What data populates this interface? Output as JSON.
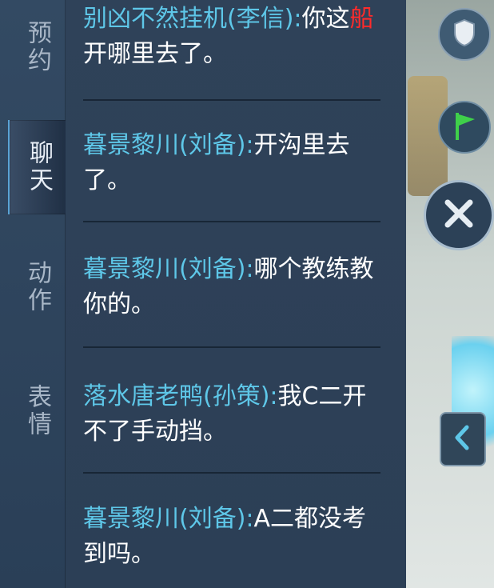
{
  "tabs": [
    {
      "label": "预约",
      "active": false
    },
    {
      "label": "聊天",
      "active": true
    },
    {
      "label": "动作",
      "active": false
    },
    {
      "label": "表情",
      "active": false
    }
  ],
  "messages": [
    {
      "sender": "别凶不然挂机(李信):",
      "text_a": "你这",
      "highlight": "船",
      "text_b": "开哪里去了。"
    },
    {
      "sender": "暮景黎川(刘备):",
      "text": "开沟里去了。"
    },
    {
      "sender": "暮景黎川(刘备):",
      "text": "哪个教练教你的。"
    },
    {
      "sender": "落水唐老鸭(孙策):",
      "text": "我C二开不了手动挡。"
    },
    {
      "sender": "暮景黎川(刘备):",
      "text": "A二都没考到吗。"
    }
  ],
  "icons": {
    "shield": "shield-icon",
    "flag": "flag-icon",
    "close": "close-icon",
    "collapse": "chevron-left-icon"
  },
  "colors": {
    "sender": "#5ec7e8",
    "highlight": "#ff2b2b",
    "panel": "#2f4259",
    "flag": "#3fd04a"
  }
}
